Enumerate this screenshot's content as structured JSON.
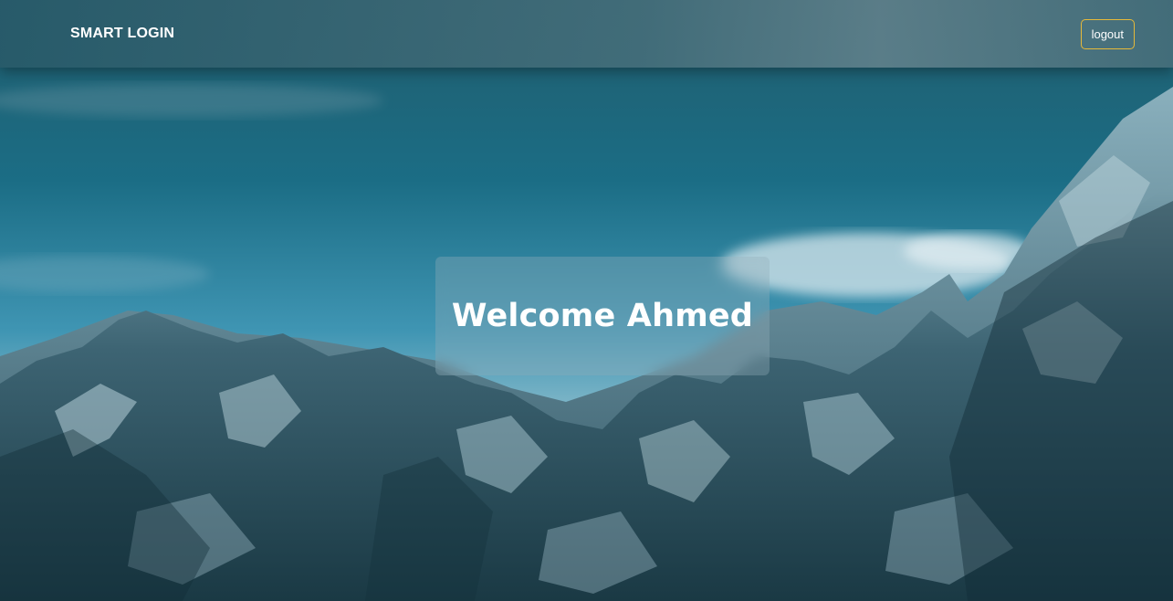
{
  "navbar": {
    "brand": "SMART LOGIN",
    "logout_label": "logout"
  },
  "main": {
    "welcome_text": "Welcome Ahmed"
  },
  "colors": {
    "logout_border": "#e6b93a",
    "text": "#ffffff",
    "sky": "#1c6a80"
  }
}
